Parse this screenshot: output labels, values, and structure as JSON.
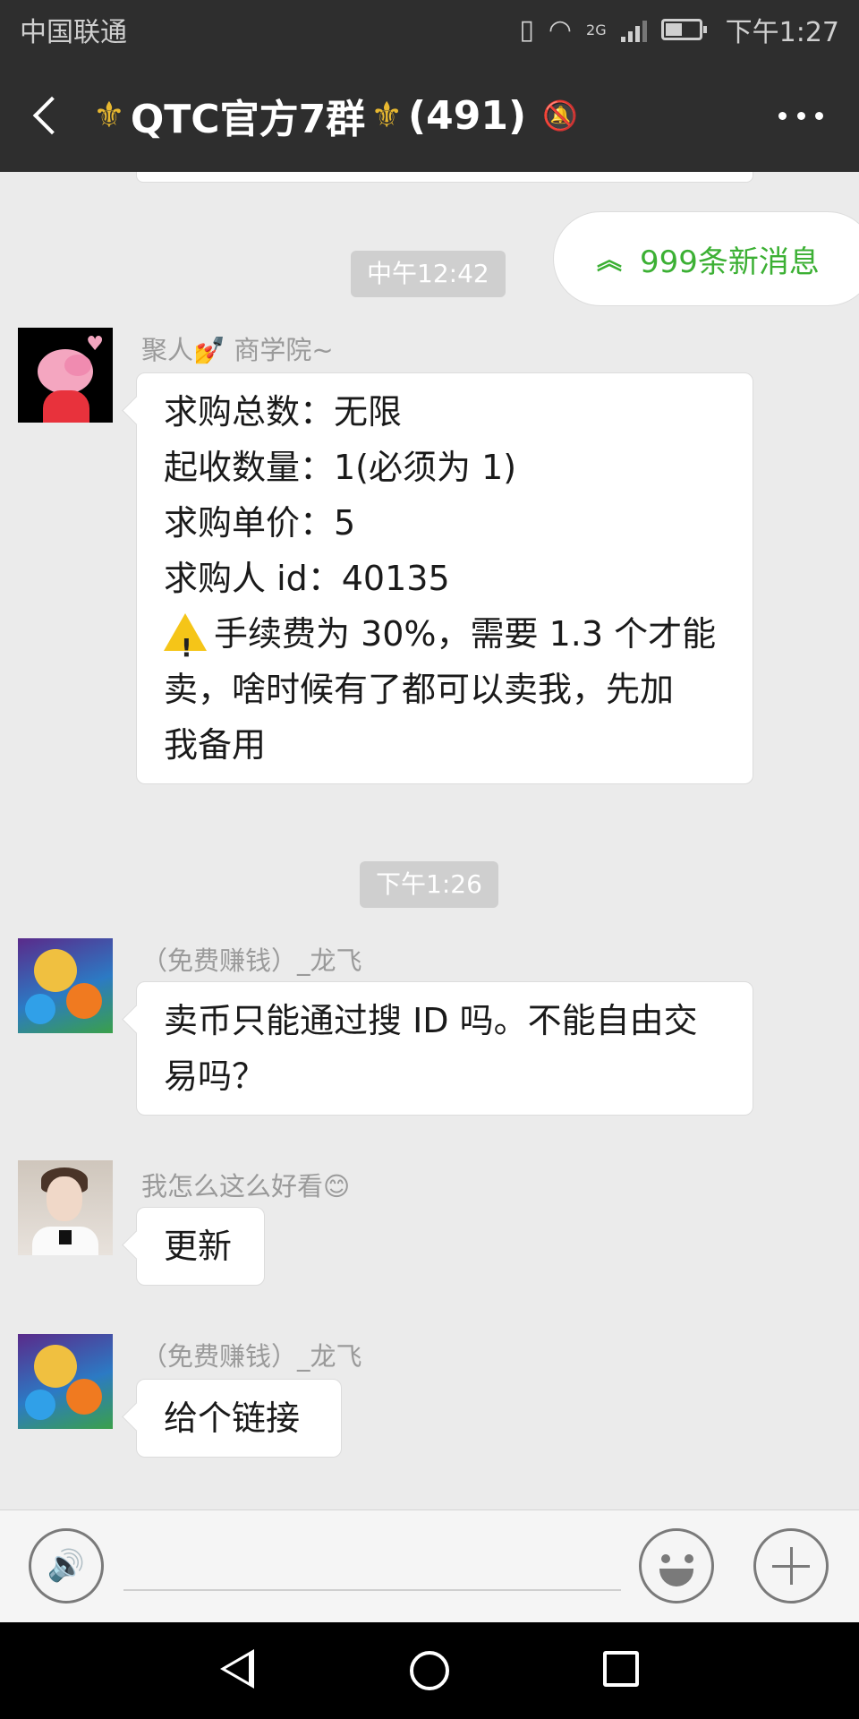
{
  "status_bar": {
    "carrier": "中国联通",
    "network": "2G",
    "time": "下午1:27"
  },
  "header": {
    "title_prefix_icon": "crown-icon",
    "title": "QTC官方7群",
    "member_count": "(491)",
    "muted": true
  },
  "new_messages_pill": {
    "label": "999条新消息",
    "color": "#3cb034"
  },
  "messages": [
    {
      "type": "time",
      "text": "中午12:42"
    },
    {
      "type": "text",
      "sender": "聚人💅 商学院~",
      "avatar": "peppa-pig-avatar",
      "lines": [
        "求购总数：无限",
        "起收数量：1(必须为 1)",
        "求购单价：5",
        "求购人 id：40135",
        "手续费为 30%，需要 1.3 个才能",
        "卖，啥时候有了都可以卖我，先加",
        "我备用"
      ]
    },
    {
      "type": "time",
      "text": "下午1:26"
    },
    {
      "type": "text",
      "sender": "（免费赚钱）_龙飞",
      "avatar": "game-characters-avatar",
      "lines": [
        "卖币只能通过搜 ID 吗。不能自由交",
        "易吗？"
      ]
    },
    {
      "type": "text",
      "sender": "我怎么这么好看😊",
      "avatar": "young-man-avatar",
      "lines": [
        "更新"
      ]
    },
    {
      "type": "text",
      "sender": "（免费赚钱）_龙飞",
      "avatar": "game-characters-avatar",
      "lines": [
        "给个链接"
      ]
    }
  ],
  "input_bar": {
    "voice_icon": "voice-icon",
    "emoji_icon": "emoji-icon",
    "plus_icon": "plus-icon",
    "placeholder": ""
  },
  "colors": {
    "header_bg": "#2e2e2e",
    "chat_bg": "#ebebeb",
    "bubble_bg": "#ffffff"
  }
}
